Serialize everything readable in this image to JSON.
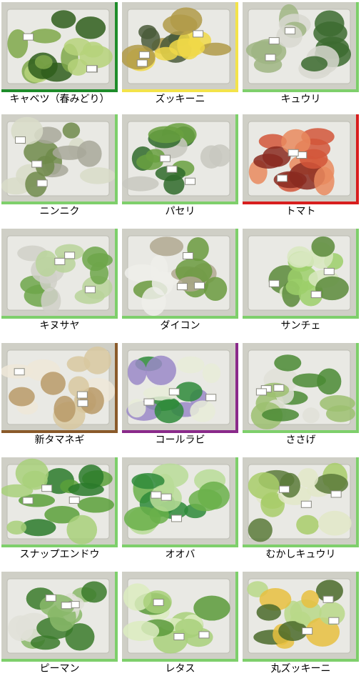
{
  "items": [
    {
      "label": "キャベツ（春みどり）",
      "colors": [
        "#7fa84a",
        "#b6d27a",
        "#2f5e1c"
      ],
      "accent": "#1e8c2a"
    },
    {
      "label": "ズッキーニ",
      "colors": [
        "#f0d848",
        "#b09a48",
        "#4a5a3a"
      ],
      "accent": "#f3e34a"
    },
    {
      "label": "キュウリ",
      "colors": [
        "#3c6b30",
        "#9fb583",
        "#d8d8d0"
      ],
      "accent": "#7ecf6b"
    },
    {
      "label": "ニンニク",
      "colors": [
        "#d8dcc8",
        "#6f8a4a",
        "#a8a89a"
      ],
      "accent": "#7ecf6b"
    },
    {
      "label": "パセリ",
      "colors": [
        "#2f6a2a",
        "#68a040",
        "#c8c8c0"
      ],
      "accent": "#7ecf6b"
    },
    {
      "label": "トマト",
      "colors": [
        "#d2563a",
        "#e98a5e",
        "#8a2a20"
      ],
      "accent": "#d81e1e"
    },
    {
      "label": "キヌサヤ",
      "colors": [
        "#6da64a",
        "#b8d49a",
        "#d0d0c8"
      ],
      "accent": "#7ecf6b"
    },
    {
      "label": "ダイコン",
      "colors": [
        "#eeeeea",
        "#6a9a3e",
        "#b0a890"
      ],
      "accent": "#7ecf6b"
    },
    {
      "label": "サンチェ",
      "colors": [
        "#9ccf6a",
        "#d8e8c0",
        "#5a8a3a"
      ],
      "accent": "#7ecf6b"
    },
    {
      "label": "新タマネギ",
      "colors": [
        "#d8c8a0",
        "#b89a68",
        "#efe8d8"
      ],
      "accent": "#8a5a2a"
    },
    {
      "label": "コールラビ",
      "colors": [
        "#9a88c8",
        "#e8ecd8",
        "#2e8a3a"
      ],
      "accent": "#8a2a8a"
    },
    {
      "label": "ささげ",
      "colors": [
        "#4a8a34",
        "#9cc070",
        "#e0e0d8"
      ],
      "accent": "#7ecf6b"
    },
    {
      "label": "スナップエンドウ",
      "colors": [
        "#5aa03a",
        "#a8d07a",
        "#2a7a2a"
      ],
      "accent": "#7ecf6b"
    },
    {
      "label": "オオバ",
      "colors": [
        "#6ab04a",
        "#b8dc98",
        "#2e8a3a"
      ],
      "accent": "#7ecf6b"
    },
    {
      "label": "むかしキュウリ",
      "colors": [
        "#a8cc6a",
        "#e2e8c8",
        "#5a7a3a"
      ],
      "accent": "#7ecf6b"
    },
    {
      "label": "ピーマン",
      "colors": [
        "#3a7a2a",
        "#8ab86a",
        "#e0e0d8"
      ],
      "accent": "#7ecf6b"
    },
    {
      "label": "レタス",
      "colors": [
        "#a8d07a",
        "#dcecc0",
        "#5a9a3a"
      ],
      "accent": "#7ecf6b"
    },
    {
      "label": "丸ズッキーニ",
      "colors": [
        "#b8d888",
        "#e8c040",
        "#4a6a2a"
      ],
      "accent": "#7ecf6b"
    }
  ]
}
